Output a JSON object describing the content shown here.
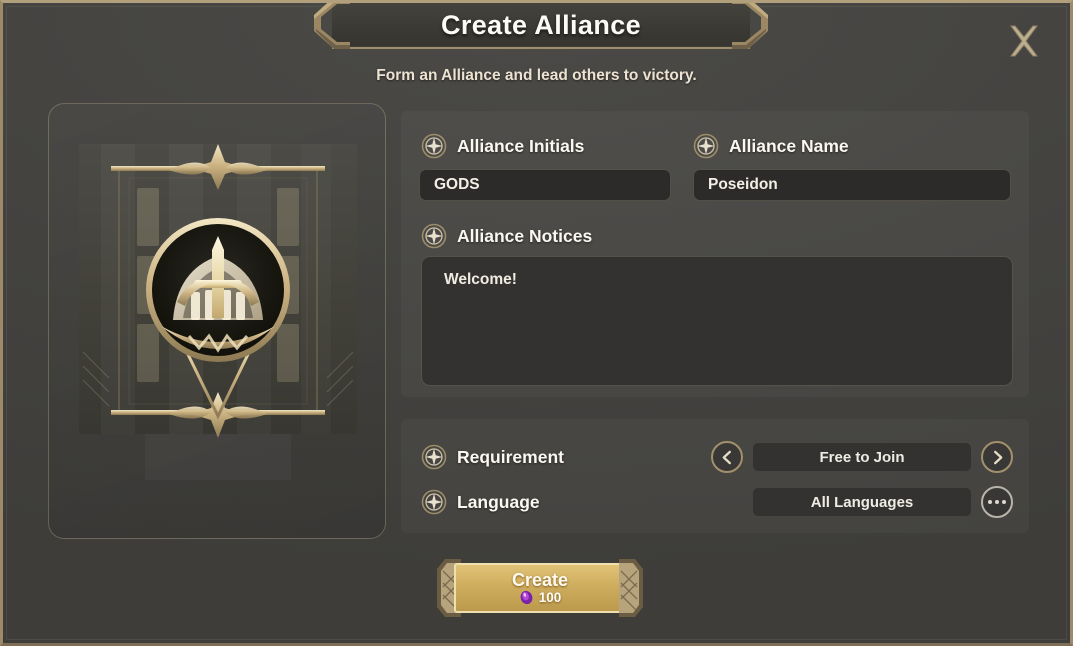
{
  "dialog": {
    "title": "Create Alliance",
    "subtitle": "Form an Alliance and lead others to victory.",
    "close_label": "×"
  },
  "emblem": {
    "name": "alliance-emblem-banner"
  },
  "form": {
    "initials": {
      "label": "Alliance Initials",
      "value": "GODS",
      "placeholder": "GODS"
    },
    "name": {
      "label": "Alliance Name",
      "value": "Poseidon",
      "placeholder": "Poseidon"
    },
    "notices": {
      "label": "Alliance Notices",
      "value": "Welcome!",
      "placeholder": "Welcome!"
    }
  },
  "settings": {
    "requirement": {
      "label": "Requirement",
      "value": "Free to Join",
      "prev_label": "‹",
      "next_label": "›"
    },
    "language": {
      "label": "Language",
      "value": "All Languages",
      "more_label": "..."
    }
  },
  "create_button": {
    "label": "Create",
    "cost": "100",
    "currency_icon": "gem-icon"
  },
  "colors": {
    "gold": "#cfad5e",
    "gold_light": "#f0dfae",
    "gold_border": "#a3916d",
    "panel": "#454441",
    "input_bg": "#2c2b29",
    "gem_purple": "#9b3fc4",
    "text": "#fbf8f1"
  }
}
